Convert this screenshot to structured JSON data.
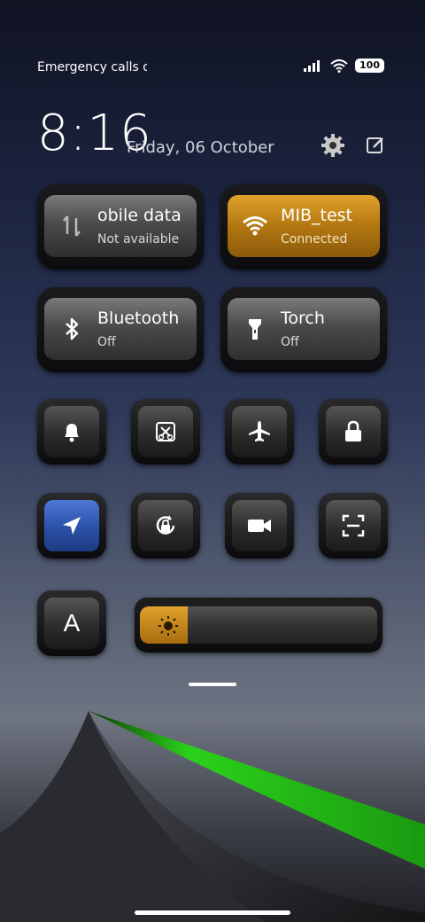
{
  "status": {
    "carrier": "Emergency calls o",
    "battery": "100"
  },
  "header": {
    "time": "8:16",
    "date": "Friday, 06 October"
  },
  "tiles": {
    "mobile_data": {
      "title": "obile data",
      "subtitle": "Not available"
    },
    "wifi": {
      "title": "MIB_test",
      "subtitle": "Connected"
    },
    "bluetooth": {
      "title": "Bluetooth",
      "subtitle": "Off"
    },
    "torch": {
      "title": "Torch",
      "subtitle": "Off"
    }
  },
  "text_size_label": "A",
  "brightness": {
    "level": 0.2
  },
  "colors": {
    "accent_orange": "#d4931f",
    "accent_blue": "#2f5bb8",
    "wallpaper_green": "#2bd11a"
  },
  "icons": [
    "signal-icon",
    "wifi-icon",
    "battery-icon",
    "gear-icon",
    "edit-icon",
    "mobile-data-icon",
    "bluetooth-icon",
    "torch-icon",
    "bell-icon",
    "screenshot-icon",
    "airplane-icon",
    "lock-icon",
    "location-icon",
    "rotation-lock-icon",
    "video-icon",
    "scan-icon",
    "brightness-icon"
  ]
}
